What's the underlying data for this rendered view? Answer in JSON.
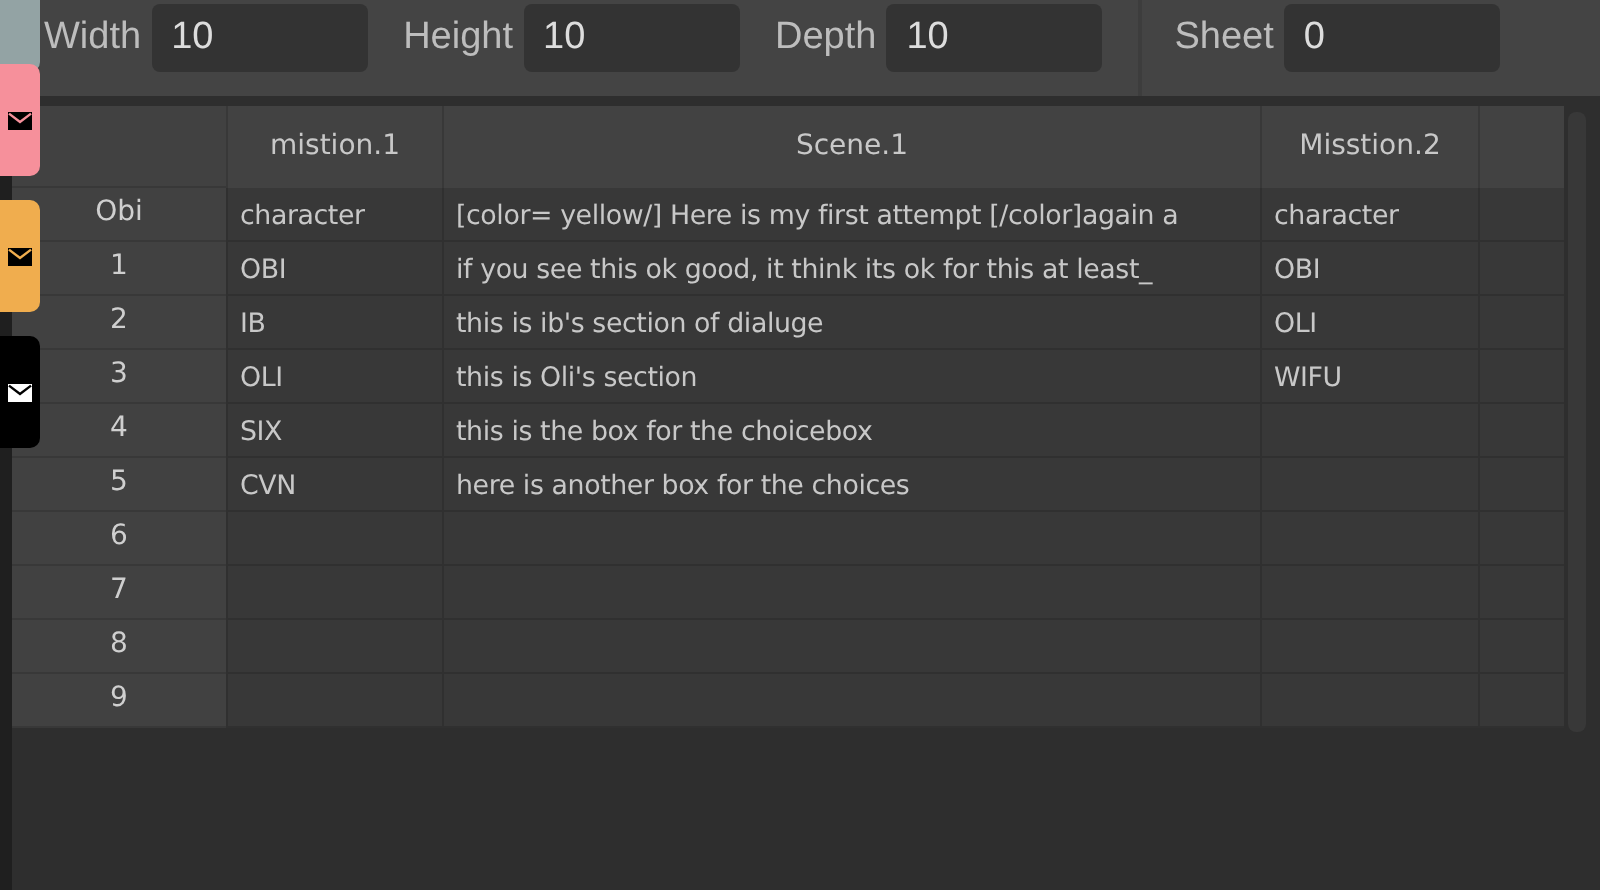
{
  "side_tabs": [
    {
      "kind": "plain",
      "color": "#93a3a4"
    },
    {
      "kind": "mail",
      "color": "#f6909b"
    },
    {
      "kind": "mail",
      "color": "#f0ad4e"
    },
    {
      "kind": "mail",
      "color": "#000000"
    }
  ],
  "toolbar": {
    "fields": [
      {
        "label": "Width",
        "value": "10"
      },
      {
        "label": "Height",
        "value": "10"
      },
      {
        "label": "Depth",
        "value": "10"
      }
    ],
    "sheet": {
      "label": "Sheet",
      "value": "0"
    }
  },
  "table": {
    "columns": [
      "mistion.1",
      "Scene.1",
      "Misstion.2",
      ""
    ],
    "rows": [
      {
        "header": "Obi",
        "cells": [
          "character",
          "[color= yellow/] Here is my first attempt [/color]again a",
          "character",
          ""
        ]
      },
      {
        "header": "1",
        "cells": [
          "OBI",
          "if you see this ok good, it think its ok for this at least_",
          "OBI",
          ""
        ]
      },
      {
        "header": "2",
        "cells": [
          "IB",
          "this is ib's section of dialuge",
          "OLI",
          ""
        ]
      },
      {
        "header": "3",
        "cells": [
          "OLI",
          "this is Oli's section",
          "WIFU",
          ""
        ]
      },
      {
        "header": "4",
        "cells": [
          "SIX",
          "this is the box for the choicebox",
          "",
          ""
        ]
      },
      {
        "header": "5",
        "cells": [
          "CVN",
          "here is another box for the choices",
          "",
          ""
        ]
      },
      {
        "header": "6",
        "cells": [
          "",
          "",
          "",
          ""
        ]
      },
      {
        "header": "7",
        "cells": [
          "",
          "",
          "",
          ""
        ]
      },
      {
        "header": "8",
        "cells": [
          "",
          "",
          "",
          ""
        ]
      },
      {
        "header": "9",
        "cells": [
          "",
          "",
          "",
          ""
        ]
      }
    ]
  }
}
